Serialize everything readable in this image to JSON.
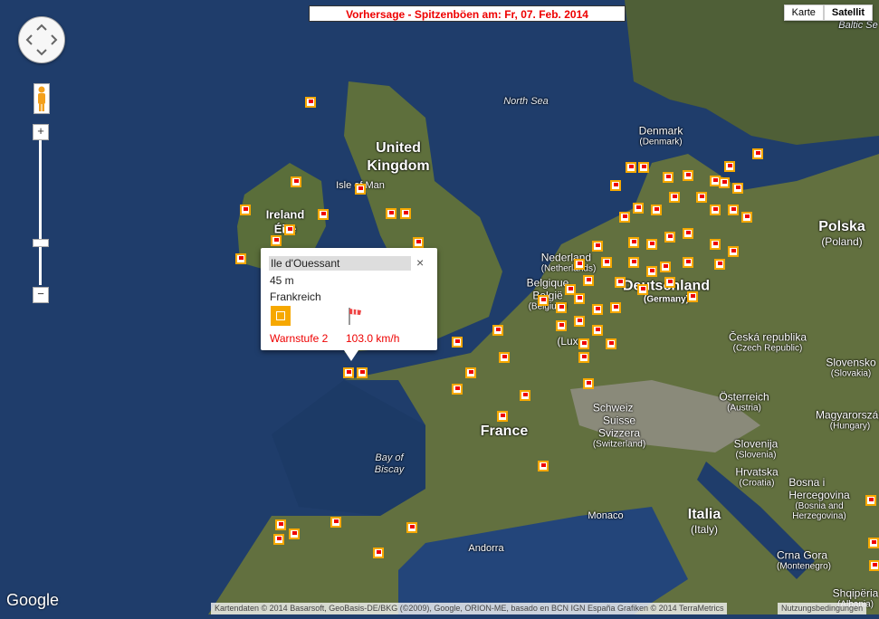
{
  "title": "Vorhersage - Spitzenböen am: Fr, 07. Feb. 2014",
  "map_type": {
    "map_label": "Karte",
    "satellite_label": "Satellit",
    "active": "Satellit"
  },
  "places": {
    "north_sea": "North Sea",
    "baltic_sea": "Baltic Se",
    "bay_of_biscay_1": "Bay of",
    "bay_of_biscay_2": "Biscay",
    "united_kingdom_1": "United",
    "united_kingdom_2": "Kingdom",
    "isle_of_man": "Isle of Man",
    "ireland_1": "Ireland",
    "ireland_2": "Éire",
    "denmark": "Denmark",
    "denmark_sub": "(Denmark)",
    "nederland": "Nederland",
    "nederland_sub": "(Netherlands)",
    "belgique_1": "Belgique",
    "belgique_2": "België",
    "belgique_sub": "(Belgium)",
    "luxembourg": "(Lux...",
    "deutschland": "Deutschland",
    "deutschland_sub": "(Germany)",
    "polska": "Polska",
    "polska_sub": "(Poland)",
    "cesko": "Česká republika",
    "cesko_sub": "(Czech Republic)",
    "slovensko": "Slovensko",
    "slovensko_sub": "(Slovakia)",
    "osterreich": "Österreich",
    "osterreich_sub": "(Austria)",
    "magyar": "Magyarország",
    "magyar_sub": "(Hungary)",
    "schweiz_1": "Schweiz",
    "schweiz_2": "Suisse",
    "schweiz_3": "Svizzera",
    "schweiz_sub": "(Switzerland)",
    "france": "France",
    "slovenija": "Slovenija",
    "slovenija_sub": "(Slovenia)",
    "hrvatska": "Hrvatska",
    "hrvatska_sub": "(Croatia)",
    "bosna_1": "Bosna i",
    "bosna_2": "Hercegovina",
    "bosna_sub1": "(Bosnia and",
    "bosna_sub2": "Herzegovina)",
    "monaco": "Monaco",
    "italia": "Italia",
    "italia_sub": "(Italy)",
    "andorra": "Andorra",
    "crna_gora": "Crna Gora",
    "crna_gora_sub": "(Montenegro)",
    "shqiperia": "Shqipëria",
    "shqiperia_sub": "(Albania)"
  },
  "popup": {
    "station": "Ile d'Ouessant",
    "altitude": "45 m",
    "country": "Frankreich",
    "warn_level": "Warnstufe 2",
    "gust_speed": "103.0 km/h",
    "close": "×"
  },
  "branding": {
    "google": "Google"
  },
  "attribution": "Kartendaten © 2014 Basarsoft, GeoBasis-DE/BKG (©2009), Google, ORION-ME, basado en BCN IGN España Grafiken © 2014 TerraMetrics",
  "terms": "Nutzungsbedingungen",
  "colors": {
    "warn_marker": "#f6a800",
    "warn_text": "#e00000",
    "sea": "#1f3d6b",
    "land": "#5a6e3a"
  }
}
